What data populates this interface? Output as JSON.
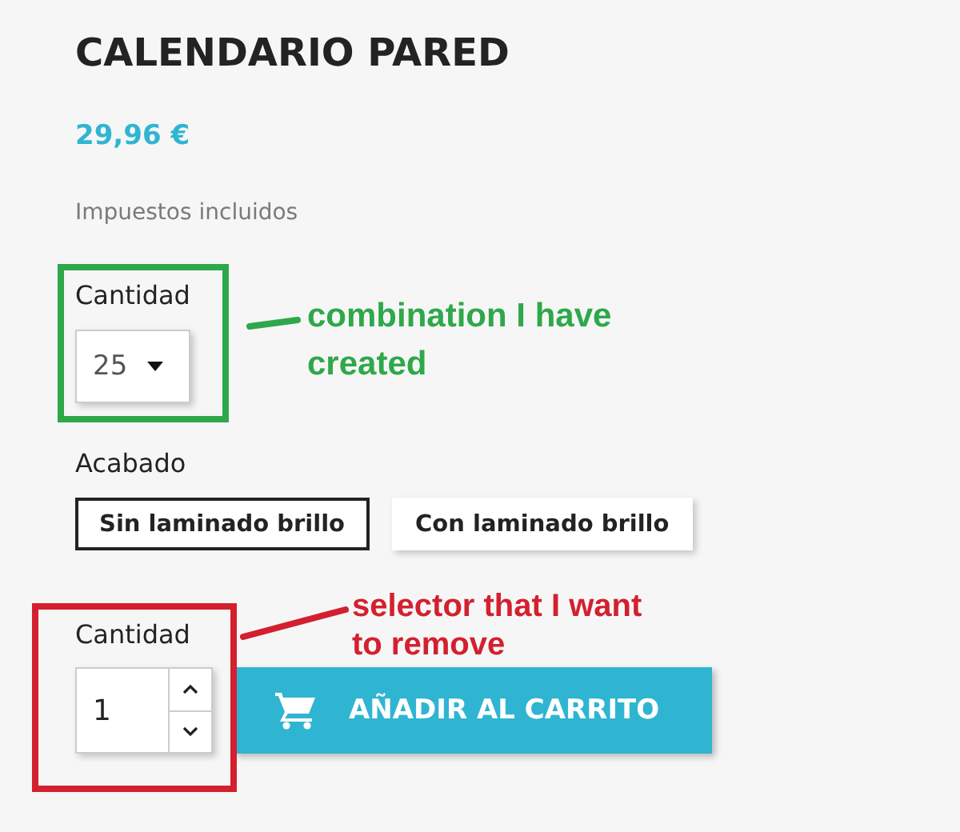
{
  "product": {
    "title": "CALENDARIO PARED",
    "price": "29,96 €",
    "tax_note": "Impuestos incluidos"
  },
  "combination": {
    "label": "Cantidad",
    "value": "25"
  },
  "finish": {
    "label": "Acabado",
    "options": [
      {
        "label": "Sin laminado brillo",
        "selected": true
      },
      {
        "label": "Con laminado brillo",
        "selected": false
      }
    ]
  },
  "quantity": {
    "label": "Cantidad",
    "value": "1"
  },
  "add_to_cart": {
    "label": "AÑADIR AL CARRITO"
  },
  "annotations": [
    {
      "text": "combination I have created",
      "color": "#2ea84a"
    },
    {
      "text": "selector that I want to remove",
      "color": "#d3202f"
    }
  ]
}
